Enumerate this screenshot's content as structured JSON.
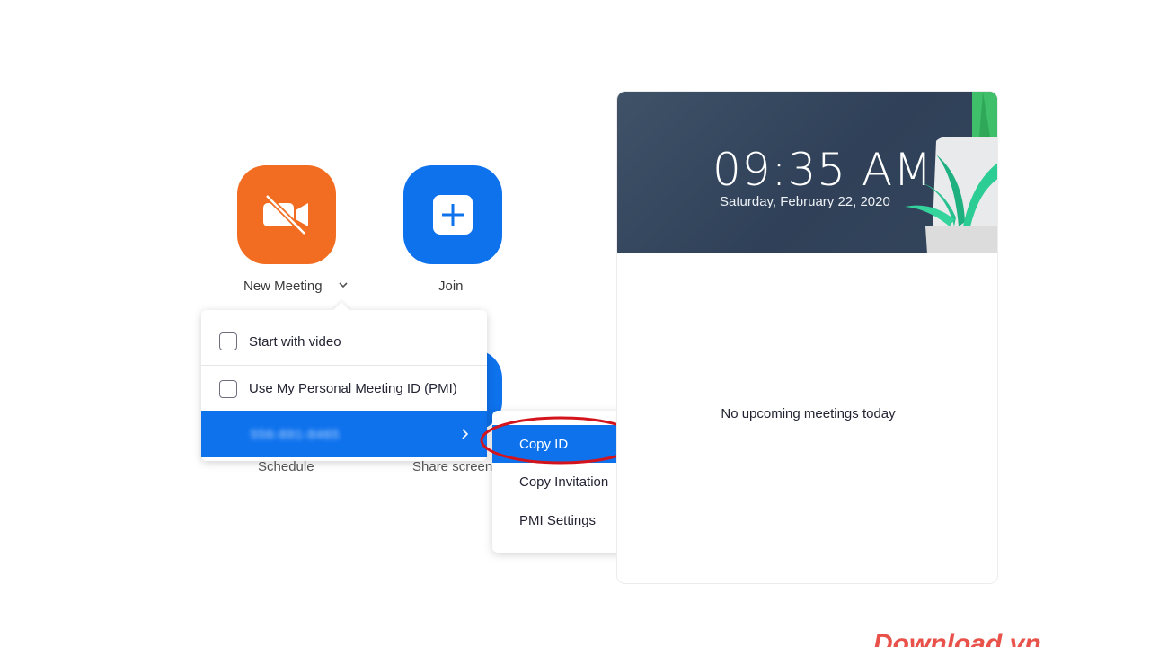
{
  "tiles": {
    "new_meeting_label": "New Meeting",
    "join_label": "Join",
    "schedule_label": "Schedule",
    "share_screen_label": "Share screen"
  },
  "dropdown": {
    "items": [
      {
        "label": "Start with video"
      },
      {
        "label": "Use My Personal Meeting ID (PMI)"
      },
      {
        "label": "556-891-8465"
      }
    ]
  },
  "submenu": {
    "items": [
      {
        "label": "Copy ID"
      },
      {
        "label": "Copy Invitation"
      },
      {
        "label": "PMI Settings"
      }
    ]
  },
  "calendar": {
    "time": "09:35 AM",
    "date": "Saturday, February 22, 2020",
    "empty_text": "No upcoming meetings today"
  },
  "watermark": "Download.vn",
  "colors": {
    "accent_blue": "#0e72ed",
    "new_meeting_orange": "#f26d21",
    "highlight_ring": "#d4141c"
  }
}
